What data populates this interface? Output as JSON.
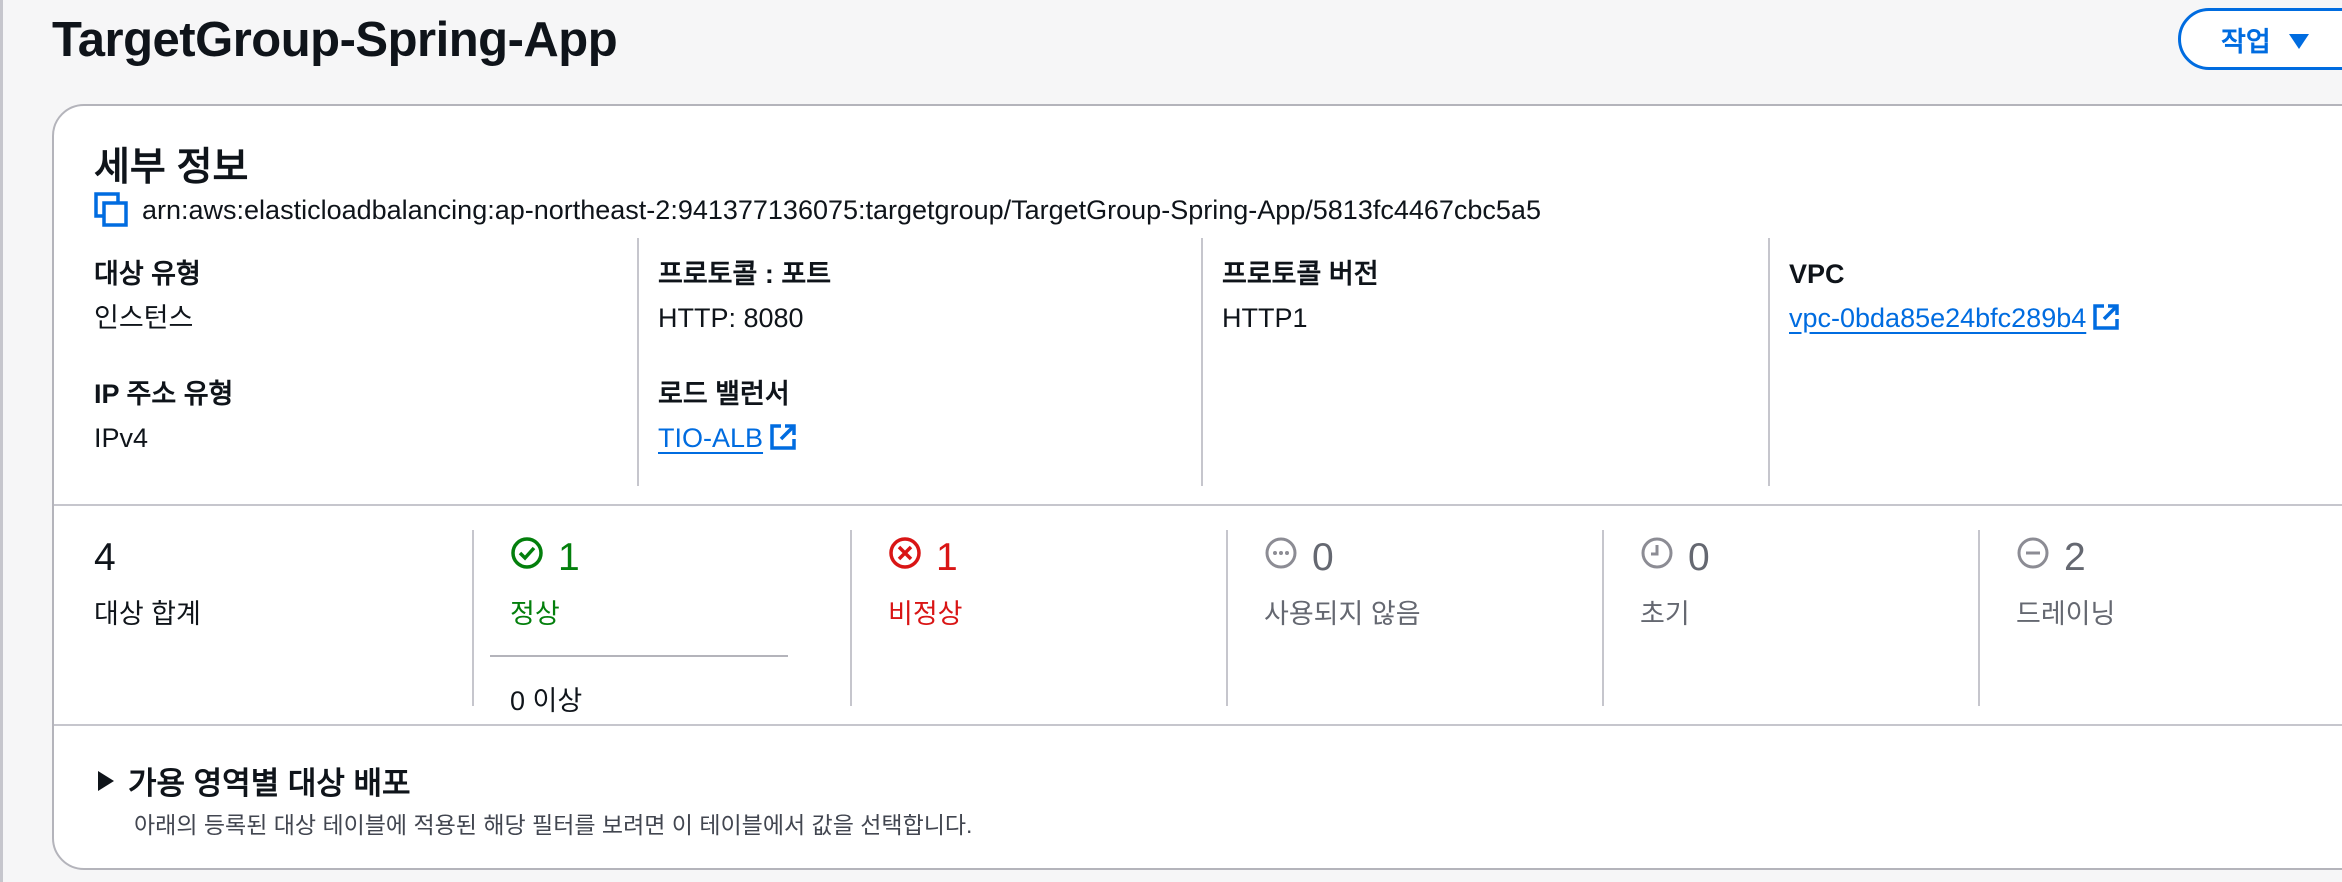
{
  "header": {
    "title": "TargetGroup-Spring-App",
    "actions_label": "작업"
  },
  "details": {
    "section_title": "세부 정보",
    "arn": "arn:aws:elasticloadbalancing:ap-northeast-2:941377136075:targetgroup/TargetGroup-Spring-App/5813fc4467cbc5a5",
    "target_type_label": "대상 유형",
    "target_type_value": "인스턴스",
    "ip_type_label": "IP 주소 유형",
    "ip_type_value": "IPv4",
    "protocol_port_label": "프로토콜 : 포트",
    "protocol_port_value": "HTTP: 8080",
    "load_balancer_label": "로드 밸런서",
    "load_balancer_value": "TIO-ALB",
    "protocol_version_label": "프로토콜 버전",
    "protocol_version_value": "HTTP1",
    "vpc_label": "VPC",
    "vpc_value": "vpc-0bda85e24bfc289b4"
  },
  "stats": {
    "total": {
      "count": "4",
      "label": "대상 합계"
    },
    "healthy": {
      "count": "1",
      "label": "정상",
      "color": "#037f0c",
      "icon": "check-circle-icon"
    },
    "anomalous": {
      "count": "0",
      "label": "이상"
    },
    "unhealthy": {
      "count": "1",
      "label": "비정상",
      "color": "#d91515",
      "icon": "x-circle-icon"
    },
    "unused": {
      "count": "0",
      "label": "사용되지 않음",
      "icon": "dots-circle-icon"
    },
    "initial": {
      "count": "0",
      "label": "초기",
      "icon": "clock-icon"
    },
    "draining": {
      "count": "2",
      "label": "드레이닝",
      "icon": "minus-circle-icon"
    }
  },
  "az_section": {
    "title": "가용 영역별 대상 배포",
    "description": "아래의 등록된 대상 테이블에 적용된 해당 필터를 보려면 이 테이블에서 값을 선택합니다."
  },
  "colors": {
    "link": "#006ce0",
    "healthy": "#037f0c",
    "unhealthy": "#d91515"
  }
}
